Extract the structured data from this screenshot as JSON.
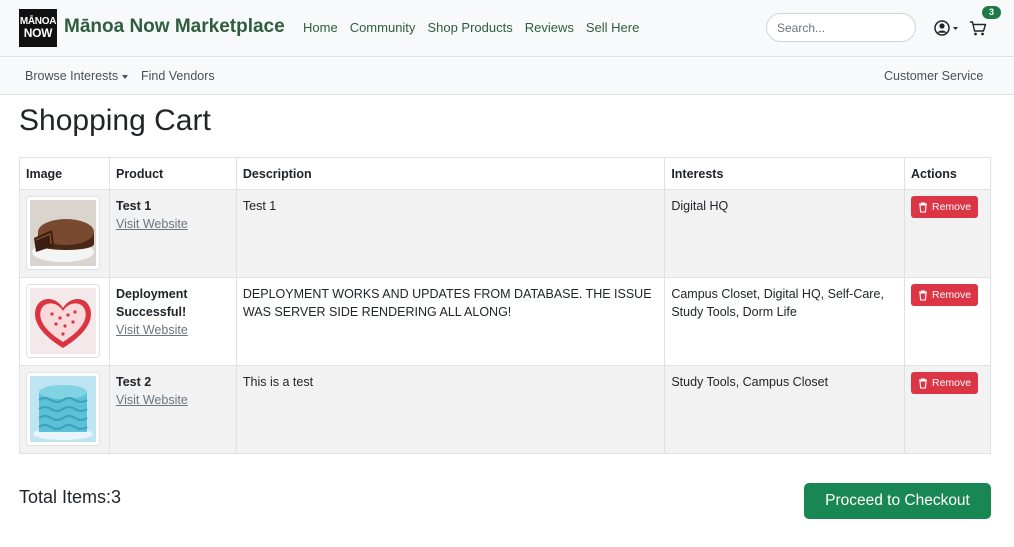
{
  "header": {
    "logo_line1": "MĀNOA",
    "logo_line2": "NOW",
    "brand": "Mānoa Now Marketplace",
    "nav": [
      "Home",
      "Community",
      "Shop Products",
      "Reviews",
      "Sell Here"
    ],
    "search_placeholder": "Search...",
    "cart_count": "3"
  },
  "subnav": {
    "browse": "Browse Interests",
    "vendors": "Find Vendors",
    "service": "Customer Service"
  },
  "page_title": "Shopping Cart",
  "table": {
    "headers": [
      "Image",
      "Product",
      "Description",
      "Interests",
      "Actions"
    ],
    "link_label": "Visit Website",
    "remove_label": "Remove",
    "rows": [
      {
        "name": "Test 1",
        "description": "Test 1",
        "interests": "Digital HQ",
        "image": "chocolate-cake"
      },
      {
        "name": "Deployment Successful!",
        "description": "DEPLOYMENT WORKS AND UPDATES FROM DATABASE. THE ISSUE WAS SERVER SIDE RENDERING ALL ALONG!",
        "interests": "Campus Closet, Digital HQ, Self-Care, Study Tools, Dorm Life",
        "image": "heart-cake"
      },
      {
        "name": "Test 2",
        "description": "This is a test",
        "interests": "Study Tools, Campus Closet",
        "image": "blue-cake"
      }
    ]
  },
  "footer": {
    "total": "Total Items:3",
    "checkout": "Proceed to Checkout"
  },
  "colors": {
    "brand": "#2e5d3f",
    "danger": "#dc3545",
    "success": "#198754"
  }
}
